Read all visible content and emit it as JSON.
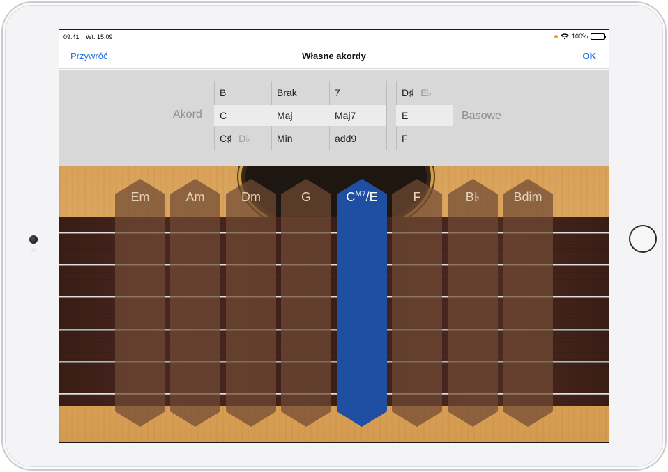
{
  "status_bar": {
    "time": "09:41",
    "date": "Wt. 15.09",
    "battery": "100%"
  },
  "nav": {
    "left_label": "Przywróć",
    "title": "Własne akordy",
    "right_label": "OK"
  },
  "picker": {
    "akord_label": "Akord",
    "basowe_label": "Basowe",
    "root": {
      "items": [
        "B",
        "C",
        "C♯"
      ],
      "alt": [
        "",
        "",
        "D♭"
      ],
      "selected": "C"
    },
    "quality": {
      "items": [
        "Brak",
        "Maj",
        "Min"
      ],
      "selected": "Maj"
    },
    "extension": {
      "items": [
        "7",
        "Maj7",
        "add9"
      ],
      "selected": "Maj7"
    },
    "bass": {
      "items": [
        "D♯",
        "E",
        "F"
      ],
      "alt": [
        "E♭",
        "",
        ""
      ],
      "selected": "E"
    }
  },
  "chords": [
    {
      "label": "Em"
    },
    {
      "label": "Am"
    },
    {
      "label": "Dm"
    },
    {
      "label": "G"
    },
    {
      "label_base": "C",
      "label_sup": "M7",
      "label_bass": "/E",
      "active": true
    },
    {
      "label": "F"
    },
    {
      "label": "B♭"
    },
    {
      "label": "Bdim"
    }
  ],
  "colors": {
    "accent": "#1a73e8",
    "active_chord": "#1f4fa3"
  }
}
